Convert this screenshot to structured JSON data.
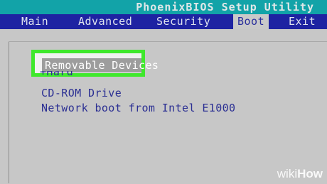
{
  "app": {
    "title": "PhoenixBIOS Setup Utility"
  },
  "menu": {
    "items": [
      {
        "label": "Main",
        "active": false
      },
      {
        "label": "Advanced",
        "active": false
      },
      {
        "label": "Security",
        "active": false
      },
      {
        "label": "Boot",
        "active": true
      },
      {
        "label": "Exit",
        "active": false
      }
    ]
  },
  "boot": {
    "selected": "Removable Devices",
    "items": [
      {
        "label": "+Hard Drive"
      },
      {
        "label": "CD-ROM Drive"
      },
      {
        "label": "Network boot from Intel E1000"
      }
    ]
  },
  "colors": {
    "title_bar": "#12a3a8",
    "menu_bar": "#1e23a2",
    "background": "#c9c9c9",
    "item_text": "#2b2f93",
    "highlight_outline": "#3fe82c"
  },
  "watermark": {
    "prefix": "wiki",
    "suffix": "How"
  }
}
